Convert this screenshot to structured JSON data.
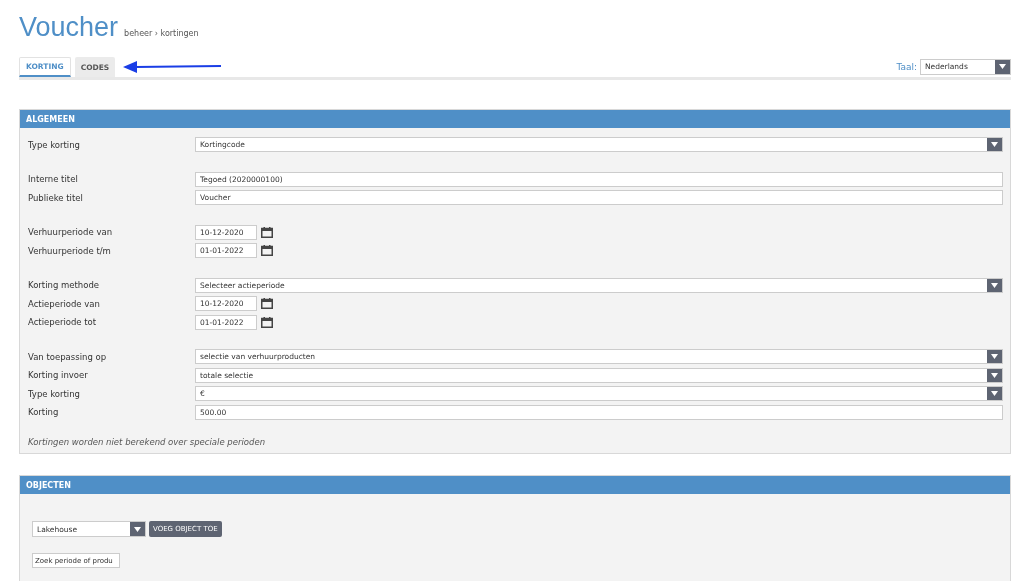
{
  "title": "Voucher",
  "breadcrumb": "beheer › kortingen",
  "tabs": [
    {
      "label": "KORTING",
      "selected": true
    },
    {
      "label": "CODES",
      "selected": false
    }
  ],
  "language": {
    "label": "Taal:",
    "value": "Nederlands"
  },
  "general": {
    "title": "ALGEMEEN",
    "groups": [
      [
        {
          "label": "Type korting",
          "kind": "select",
          "value": "Kortingcode"
        }
      ],
      [
        {
          "label": "Interne titel",
          "kind": "text",
          "value": "Tegoed (2020000100)"
        },
        {
          "label": "Publieke titel",
          "kind": "text",
          "value": "Voucher"
        }
      ],
      [
        {
          "label": "Verhuurperiode van",
          "kind": "date",
          "value": "10-12-2020"
        },
        {
          "label": "Verhuurperiode t/m",
          "kind": "date",
          "value": "01-01-2022"
        }
      ],
      [
        {
          "label": "Korting methode",
          "kind": "select",
          "value": "Selecteer actieperiode"
        },
        {
          "label": "Actieperiode van",
          "kind": "date",
          "value": "10-12-2020"
        },
        {
          "label": "Actieperiode tot",
          "kind": "date",
          "value": "01-01-2022"
        }
      ],
      [
        {
          "label": "Van toepassing op",
          "kind": "select",
          "value": "selectie van verhuurproducten"
        },
        {
          "label": "Korting invoer",
          "kind": "select",
          "value": "totale selectie"
        },
        {
          "label": "Type korting",
          "kind": "select",
          "value": "€"
        },
        {
          "label": "Korting",
          "kind": "text",
          "value": "500.00"
        }
      ]
    ],
    "note": "Kortingen worden niet berekend over speciale perioden"
  },
  "objects": {
    "title": "OBJECTEN",
    "object_select": "Lakehouse",
    "add_button": "VOEG OBJECT TOE",
    "search_placeholder": "Zoek periode of produ"
  }
}
